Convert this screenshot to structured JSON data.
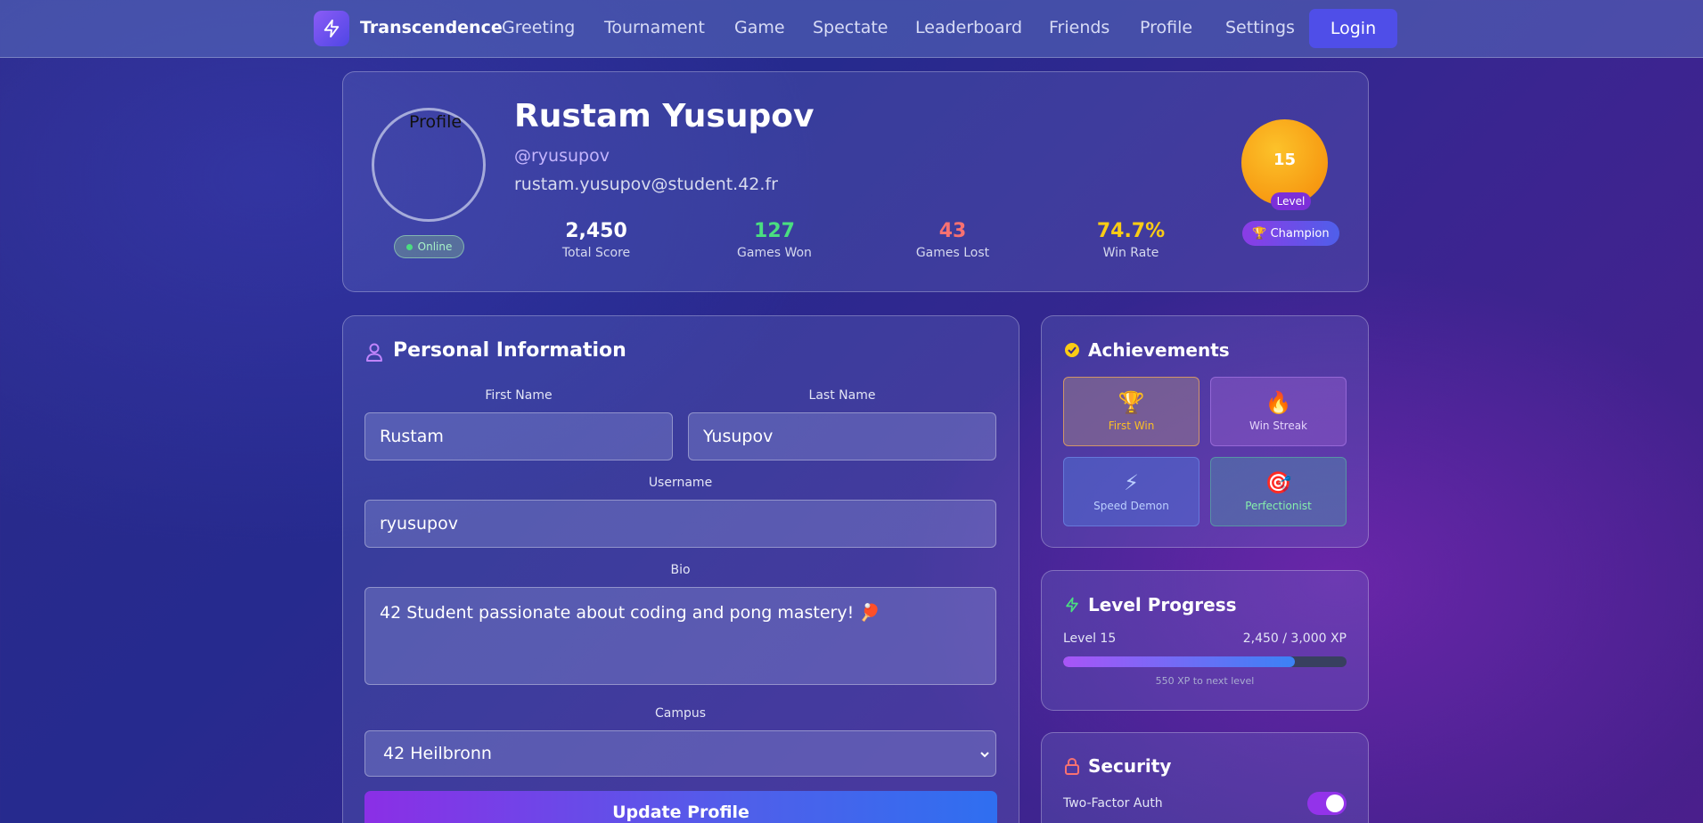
{
  "nav": {
    "brand": "Transcendence",
    "items": [
      "Greeting",
      "Tournament",
      "Game",
      "Spectate",
      "Leaderboard",
      "Friends",
      "Profile",
      "Settings"
    ],
    "login_label": "Login"
  },
  "profile": {
    "avatar_alt": "Profile",
    "status": "Online",
    "name": "Rustam Yusupov",
    "handle": "@ryusupov",
    "email": "rustam.yusupov@student.42.fr",
    "stats": [
      {
        "value": "2,450",
        "label": "Total Score",
        "color": "#ffffff"
      },
      {
        "value": "127",
        "label": "Games Won",
        "color": "#4ade80"
      },
      {
        "value": "43",
        "label": "Games Lost",
        "color": "#f87171"
      },
      {
        "value": "74.7%",
        "label": "Win Rate",
        "color": "#facc15"
      }
    ],
    "level": "15",
    "level_tag": "Level",
    "rank_icon": "🏆",
    "rank": "Champion"
  },
  "personal_info": {
    "title": "Personal Information",
    "first_name_label": "First Name",
    "first_name": "Rustam",
    "last_name_label": "Last Name",
    "last_name": "Yusupov",
    "username_label": "Username",
    "username": "ryusupov",
    "bio_label": "Bio",
    "bio": "42 Student passionate about coding and pong mastery! 🏓",
    "campus_label": "Campus",
    "campus": "42 Heilbronn",
    "update_label": "Update Profile"
  },
  "achievements": {
    "title": "Achievements",
    "items": [
      {
        "emoji": "🏆",
        "label": "First Win"
      },
      {
        "emoji": "🔥",
        "label": "Win Streak"
      },
      {
        "emoji": "⚡",
        "label": "Speed Demon"
      },
      {
        "emoji": "🎯",
        "label": "Perfectionist"
      }
    ]
  },
  "level_progress": {
    "title": "Level Progress",
    "level_label": "Level 15",
    "xp_label": "2,450 / 3,000 XP",
    "progress_fraction": 0.8167,
    "next_label": "550 XP to next level"
  },
  "security": {
    "title": "Security",
    "two_factor_label": "Two-Factor Auth",
    "two_factor_enabled": true
  }
}
